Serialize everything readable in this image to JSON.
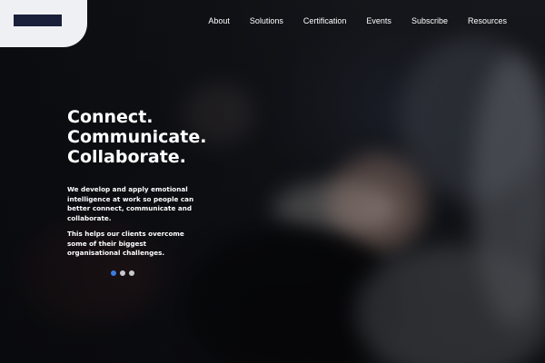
{
  "nav": {
    "items": [
      "About",
      "Solutions",
      "Certification",
      "Events",
      "Subscribe",
      "Resources"
    ]
  },
  "hero": {
    "headline": [
      "Connect.",
      "Communicate.",
      "Collaborate."
    ],
    "paragraph1": "We develop and apply emotional intelligence at work so people can better connect, communicate and collaborate.",
    "paragraph2": "This helps our clients overcome some of their biggest organisational challenges.",
    "carousel": {
      "slides": 3,
      "active_index": 0
    }
  },
  "colors": {
    "logo_background": "#eef0f3",
    "logo_mark": "#1a1f3a",
    "dot_active": "#3a7be0",
    "dot_inactive": "#c7c9cd"
  }
}
